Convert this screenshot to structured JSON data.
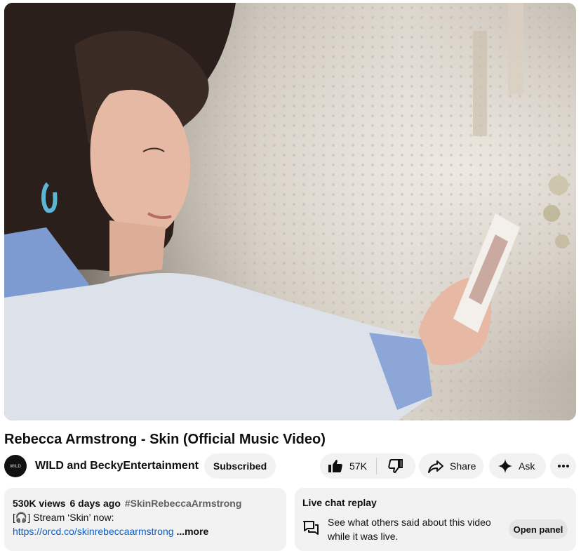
{
  "video": {
    "title": "Rebecca Armstrong - Skin (Official Music Video)"
  },
  "channel": {
    "name": "WILD and BeckyEntertainment",
    "avatar_text": "WILD",
    "subscribe_label": "Subscribed"
  },
  "actions": {
    "like_count": "57K",
    "share_label": "Share",
    "ask_label": "Ask"
  },
  "description": {
    "views": "530K views",
    "age": "6 days ago",
    "hashtag": "#SkinRebeccaArmstrong",
    "line1": "[🎧] Stream ‘Skin’ now:",
    "link": "https://orcd.co/skinrebeccaarmstrong",
    "more_label": "...more"
  },
  "live_chat": {
    "title": "Live chat replay",
    "text": "See what others said about this video while it was live.",
    "button_label": "Open panel"
  }
}
